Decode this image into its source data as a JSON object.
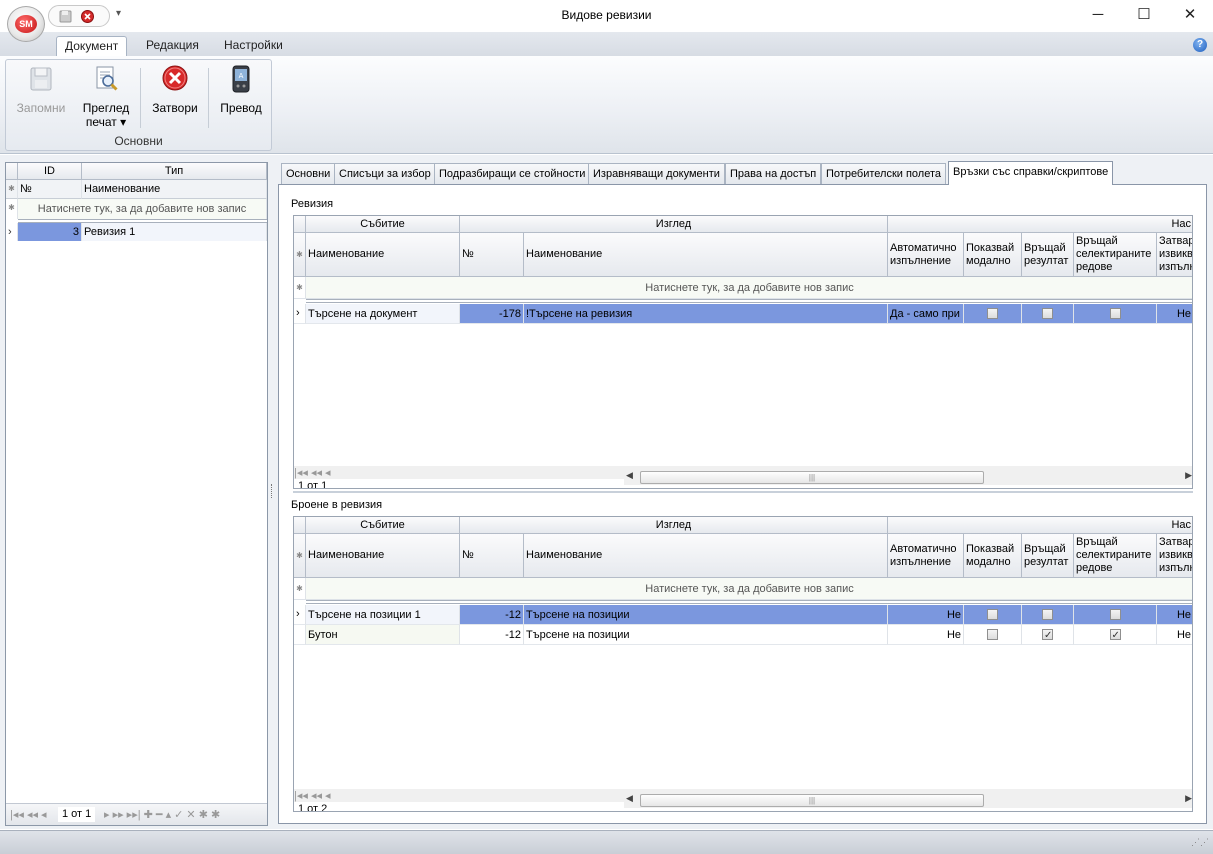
{
  "window": {
    "title": "Видове ревизии",
    "minimize": "─",
    "maximize": "☐",
    "close": "✕"
  },
  "app_logo": "SM",
  "quick_access_arrow": "▾",
  "ribbon_tabs": [
    "Документ",
    "Редакция",
    "Настройки"
  ],
  "help_label": "?",
  "ribbon_group": {
    "label": "Основни"
  },
  "ribbon_buttons": {
    "save": {
      "label": "Запомни"
    },
    "preview": {
      "label_line1": "Преглед",
      "label_line2": "печат ▾"
    },
    "close": {
      "label": "Затвори"
    },
    "translate": {
      "label": "Превод"
    }
  },
  "left_grid": {
    "columns": [
      "ID",
      "Тип"
    ],
    "filter_row": [
      "№",
      "Наименование"
    ],
    "new_row_text": "Натиснете тук, за да добавите нов запис",
    "rows": [
      {
        "id": "3",
        "type": "Ревизия 1"
      }
    ],
    "nav_text": "1 от 1"
  },
  "tabs": [
    "Основни",
    "Списъци за избор",
    "Подразбиращи се стойности",
    "Изравняващи документи",
    "Права на достъп",
    "Потребителски полета",
    "Връзки със справки/скриптове"
  ],
  "band_headers": [
    "Събитие",
    "Изглед",
    "Нас"
  ],
  "columns": [
    "Наименование",
    "№",
    "Наименование",
    "Автоматично изпълнение",
    "Показвай модално",
    "Връщай резултат",
    "Връщай селектираните редове",
    "Затвар. извикв. изпълн."
  ],
  "grid1": {
    "title": "Ревизия",
    "new_row_text": "Натиснете тук, за да добавите нов запис",
    "rows": [
      {
        "event": "Търсене на документ",
        "num": "-178",
        "view": "!Търсене на ревизия",
        "auto": "Да - само при",
        "modal": false,
        "result": false,
        "selected": false,
        "close": "Не"
      }
    ],
    "nav_text": "1 от 1"
  },
  "grid2": {
    "title": "Броене в ревизия",
    "new_row_text": "Натиснете тук, за да добавите нов запис",
    "rows": [
      {
        "event": "Търсене на позиции 1",
        "num": "-12",
        "view": "Търсене на позиции",
        "auto": "Не",
        "modal": false,
        "result": false,
        "selected": false,
        "close": "Не"
      },
      {
        "event": "Бутон",
        "num": "-12",
        "view": "Търсене на позиции",
        "auto": "Не",
        "modal": false,
        "result": true,
        "selected": true,
        "close": "Не"
      }
    ],
    "nav_text": "1 от 2"
  },
  "scroll_grip": "|||",
  "colors": {
    "selection": "#7b97de",
    "accent": "#c41414"
  }
}
